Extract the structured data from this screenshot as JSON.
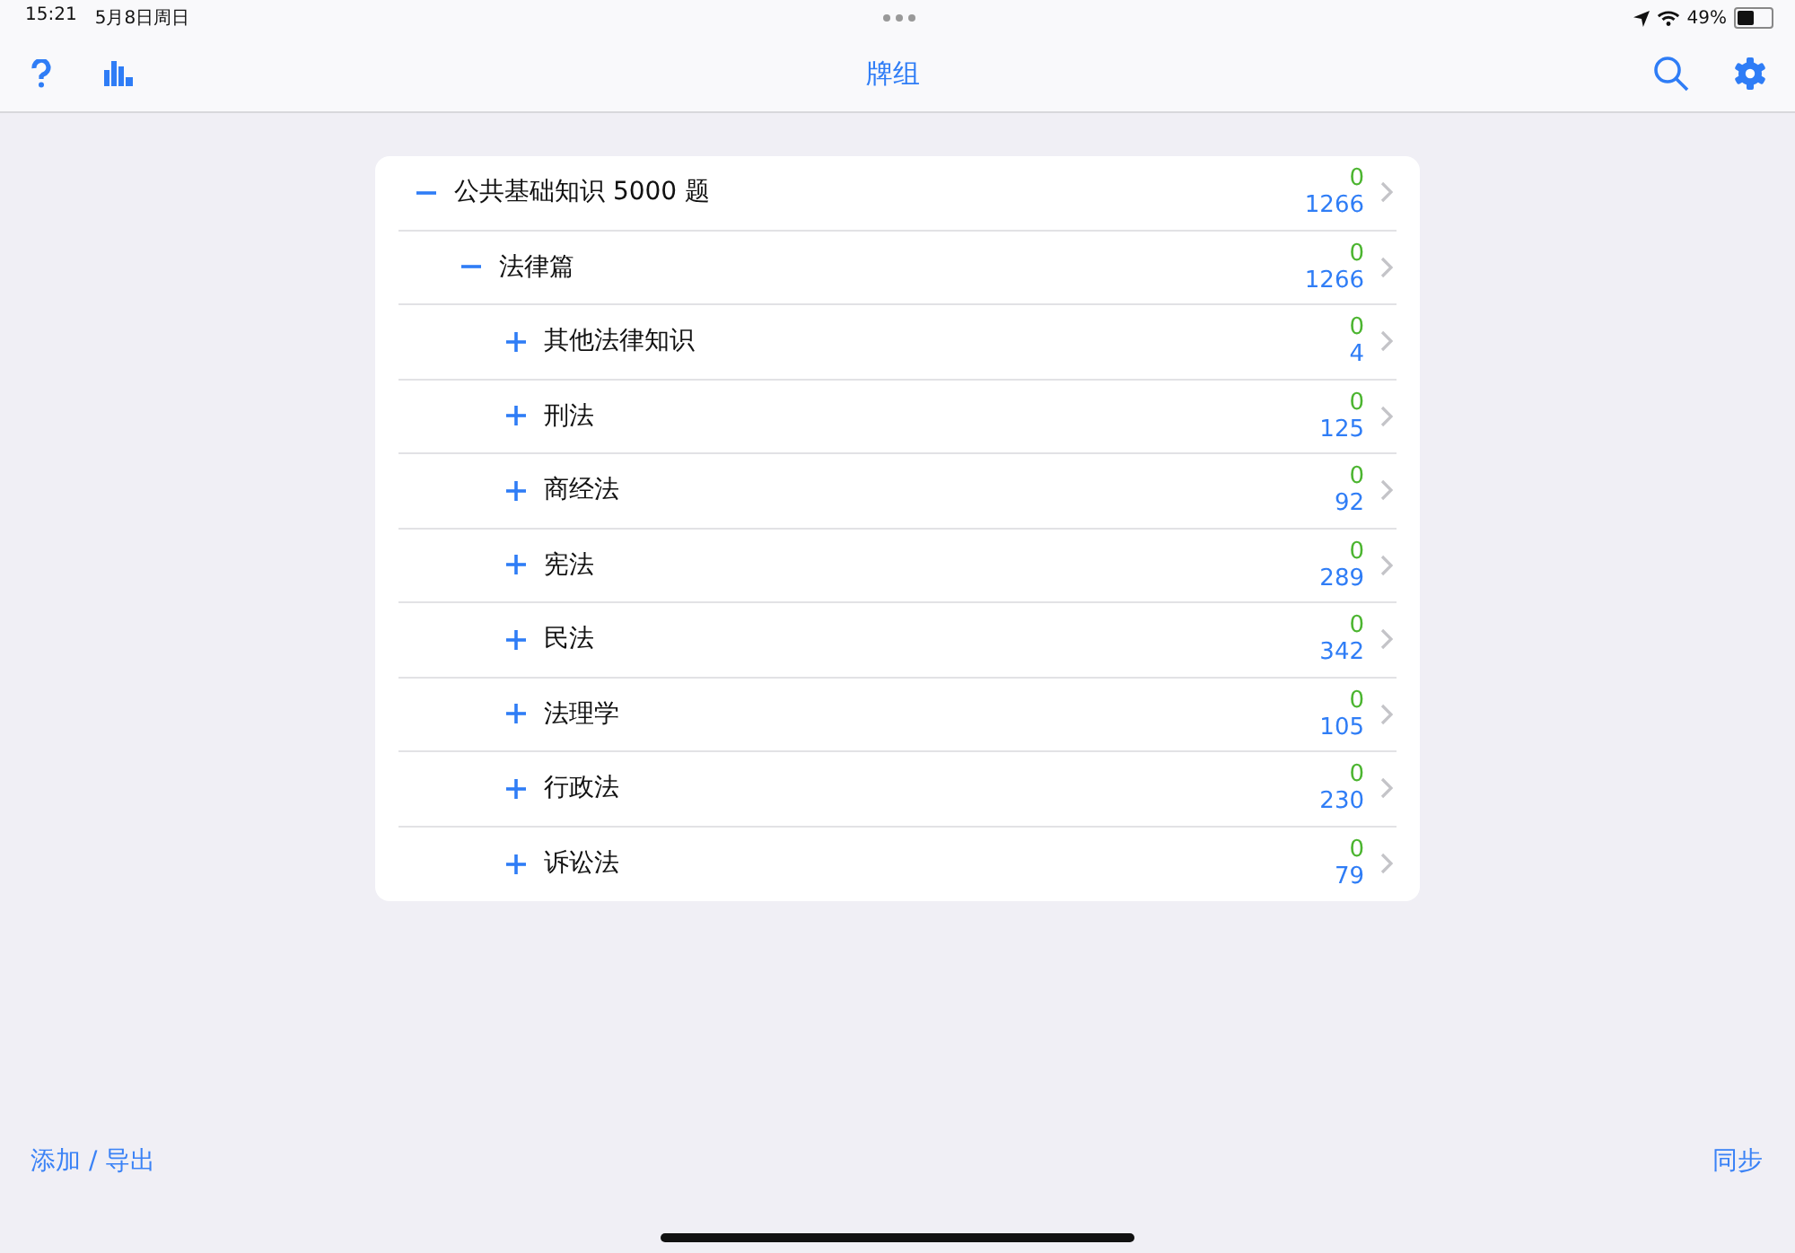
{
  "status_bar": {
    "time": "15:21",
    "date": "5月8日周日",
    "battery": "49%"
  },
  "nav_bar": {
    "title": "牌组"
  },
  "decks": [
    {
      "name": "公共基础知识 5000 题",
      "expanded": true,
      "due": "0",
      "total": "1266",
      "children": [
        {
          "name": "法律篇",
          "expanded": true,
          "due": "0",
          "total": "1266",
          "children": [
            {
              "name": "其他法律知识",
              "expanded": false,
              "due": "0",
              "total": "4"
            },
            {
              "name": "刑法",
              "expanded": false,
              "due": "0",
              "total": "125"
            },
            {
              "name": "商经法",
              "expanded": false,
              "due": "0",
              "total": "92"
            },
            {
              "name": "宪法",
              "expanded": false,
              "due": "0",
              "total": "289"
            },
            {
              "name": "民法",
              "expanded": false,
              "due": "0",
              "total": "342"
            },
            {
              "name": "法理学",
              "expanded": false,
              "due": "0",
              "total": "105"
            },
            {
              "name": "行政法",
              "expanded": false,
              "due": "0",
              "total": "230"
            },
            {
              "name": "诉讼法",
              "expanded": false,
              "due": "0",
              "total": "79"
            }
          ]
        }
      ]
    }
  ],
  "toolbar": {
    "left": "添加 / 导出",
    "right": "同步"
  }
}
